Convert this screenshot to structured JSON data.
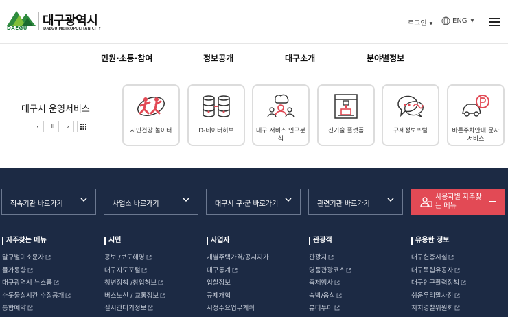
{
  "header": {
    "logo_mark": "DAEGU",
    "logo_name": "대구광역시",
    "logo_sub": "DAEGU METROPOLITAN CITY",
    "login": "로그인",
    "lang": "ENG",
    "icons": {
      "globe": "globe-icon",
      "menu": "hamburger-icon"
    }
  },
  "nav": [
    "민원·소통·참여",
    "정보공개",
    "대구소개",
    "분야별정보"
  ],
  "services": {
    "title": "대구시 운영서비스",
    "controls": [
      "‹",
      "II",
      "›",
      "grid"
    ],
    "cards": [
      {
        "label": "시민건강 놀이터",
        "icon": "runner-icon"
      },
      {
        "label": "D-데이터허브",
        "icon": "database-icon"
      },
      {
        "label": "대구 서비스 인구분석",
        "icon": "people-analysis-icon"
      },
      {
        "label": "신기술 플랫폼",
        "icon": "3d-printer-icon"
      },
      {
        "label": "규제정보포털",
        "icon": "speech-bubble-icon"
      },
      {
        "label": "바른주차안내 문자서비스",
        "icon": "parking-car-icon"
      }
    ]
  },
  "footer": {
    "selects": [
      "직속기관 바로가기",
      "사업소 바로가기",
      "대구시 구·군 바로가기",
      "관련기관 바로가기"
    ],
    "favorite": "사용자별 자주찾는 메뉴",
    "columns": [
      {
        "title": "자주찾는 메뉴",
        "items": [
          {
            "t": "달구벌미소문자",
            "ext": true
          },
          {
            "t": "물가동향",
            "ext": true
          },
          {
            "t": "대구광역시 뉴스룸",
            "ext": true
          },
          {
            "t": "수돗물실시간 수질공개",
            "ext": true
          },
          {
            "t": "통합예약",
            "ext": true
          }
        ]
      },
      {
        "title": "시민",
        "items": [
          {
            "t": "공보 /보도해명",
            "ext": true
          },
          {
            "t": "대구지도포털",
            "ext": true
          },
          {
            "t": "청년정책 /창업허브",
            "ext": true
          },
          {
            "t": "버스노선 / 교통정보",
            "ext": true
          },
          {
            "t": "실시간대기정보",
            "ext": true
          }
        ]
      },
      {
        "title": "사업자",
        "items": [
          {
            "t": "개별주택가격/공시지가",
            "ext": false
          },
          {
            "t": "대구통계",
            "ext": true
          },
          {
            "t": "입찰정보",
            "ext": false
          },
          {
            "t": "규제개혁",
            "ext": false
          },
          {
            "t": "시정주요업무계획",
            "ext": false
          }
        ]
      },
      {
        "title": "관광객",
        "items": [
          {
            "t": "관광지",
            "ext": true
          },
          {
            "t": "명품관광코스",
            "ext": true
          },
          {
            "t": "축제행사",
            "ext": true
          },
          {
            "t": "숙박/음식",
            "ext": true
          },
          {
            "t": "뷰티투어",
            "ext": true
          }
        ]
      },
      {
        "title": "유용한 정보",
        "items": [
          {
            "t": "대구헌충시설",
            "ext": true
          },
          {
            "t": "대구독립유공자",
            "ext": true
          },
          {
            "t": "대구인구활력정책",
            "ext": true
          },
          {
            "t": "쉬운우리말사전",
            "ext": true
          },
          {
            "t": "지치경찰위원회",
            "ext": true
          }
        ]
      }
    ]
  },
  "colors": {
    "accent_red": "#e24a55",
    "navy": "#1c2a44",
    "logo_green": "#1a7a3a"
  }
}
